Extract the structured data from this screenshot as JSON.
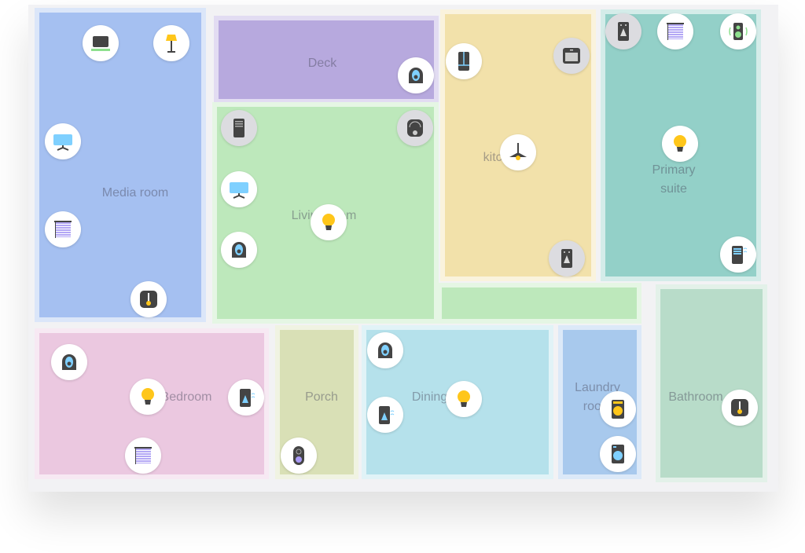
{
  "rooms": [
    {
      "id": "media-room",
      "label": "Media room",
      "color": "#a5c0f1"
    },
    {
      "id": "deck",
      "label": "Deck",
      "color": "#b7a9de"
    },
    {
      "id": "living-room",
      "label": "Living room",
      "color": "#bde8bb"
    },
    {
      "id": "kitchen",
      "label": "kitchen",
      "color": "#f2e1aa"
    },
    {
      "id": "primary-suite",
      "label": "Primary\nsuite",
      "color": "#93d0c8"
    },
    {
      "id": "bedroom",
      "label": "Bedroom",
      "color": "#ebc8e0"
    },
    {
      "id": "porch",
      "label": "Porch",
      "color": "#d9e0b6"
    },
    {
      "id": "dining-room",
      "label": "Dining room",
      "color": "#b5e1eb"
    },
    {
      "id": "laundry-room",
      "label": "Laundry\nroom",
      "color": "#a8c9ed"
    },
    {
      "id": "bathroom",
      "label": "Bathroom",
      "color": "#b8dcc9"
    }
  ],
  "devices": [
    {
      "room": "media-room",
      "type": "display",
      "bg": "white"
    },
    {
      "room": "media-room",
      "type": "floor-lamp",
      "bg": "white"
    },
    {
      "room": "media-room",
      "type": "tv",
      "bg": "white"
    },
    {
      "room": "media-room",
      "type": "blinds",
      "bg": "white"
    },
    {
      "room": "media-room",
      "type": "thermostat",
      "bg": "white"
    },
    {
      "room": "deck",
      "type": "camera",
      "bg": "white"
    },
    {
      "room": "living-room",
      "type": "router",
      "bg": "gray"
    },
    {
      "room": "living-room",
      "type": "robot-vacuum",
      "bg": "gray"
    },
    {
      "room": "living-room",
      "type": "tv",
      "bg": "white"
    },
    {
      "room": "living-room",
      "type": "camera",
      "bg": "white"
    },
    {
      "room": "living-room",
      "type": "bulb",
      "bg": "white"
    },
    {
      "room": "kitchen",
      "type": "fridge",
      "bg": "white"
    },
    {
      "room": "kitchen",
      "type": "oven",
      "bg": "gray"
    },
    {
      "room": "kitchen",
      "type": "pendant-light",
      "bg": "white"
    },
    {
      "room": "kitchen",
      "type": "air-purifier",
      "bg": "gray"
    },
    {
      "room": "primary-suite",
      "type": "air-purifier",
      "bg": "gray"
    },
    {
      "room": "primary-suite",
      "type": "blinds",
      "bg": "white"
    },
    {
      "room": "primary-suite",
      "type": "speaker",
      "bg": "white"
    },
    {
      "room": "primary-suite",
      "type": "bulb",
      "bg": "white"
    },
    {
      "room": "primary-suite",
      "type": "air-conditioner",
      "bg": "white"
    },
    {
      "room": "bedroom",
      "type": "camera",
      "bg": "white"
    },
    {
      "room": "bedroom",
      "type": "bulb",
      "bg": "white"
    },
    {
      "room": "bedroom",
      "type": "humidifier",
      "bg": "white"
    },
    {
      "room": "bedroom",
      "type": "blinds",
      "bg": "white"
    },
    {
      "room": "porch",
      "type": "doorbell",
      "bg": "white"
    },
    {
      "room": "dining-room",
      "type": "camera",
      "bg": "white"
    },
    {
      "room": "dining-room",
      "type": "humidifier",
      "bg": "white"
    },
    {
      "room": "dining-room",
      "type": "bulb",
      "bg": "white"
    },
    {
      "room": "laundry-room",
      "type": "dryer",
      "bg": "white"
    },
    {
      "room": "laundry-room",
      "type": "washer",
      "bg": "white"
    },
    {
      "room": "bathroom",
      "type": "thermostat",
      "bg": "white"
    }
  ]
}
